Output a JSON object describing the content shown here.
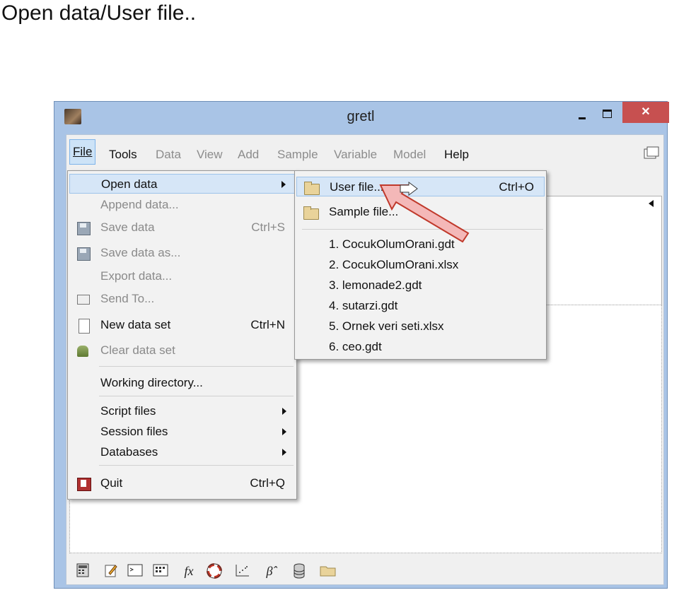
{
  "slide": {
    "title": "Open data/User file.."
  },
  "window": {
    "title": "gretl",
    "close_glyph": "✕",
    "menubar": [
      {
        "label": "File",
        "state": "active"
      },
      {
        "label": "Tools",
        "state": "enabled"
      },
      {
        "label": "Data",
        "state": "disabled"
      },
      {
        "label": "View",
        "state": "disabled"
      },
      {
        "label": "Add",
        "state": "disabled"
      },
      {
        "label": "Sample",
        "state": "disabled"
      },
      {
        "label": "Variable",
        "state": "disabled"
      },
      {
        "label": "Model",
        "state": "disabled"
      },
      {
        "label": "Help",
        "state": "enabled"
      }
    ]
  },
  "file_menu": {
    "items": [
      {
        "label": "Open data",
        "shortcut": "",
        "submenu": true,
        "highlighted": true,
        "disabled": false,
        "icon": ""
      },
      {
        "label": "Append data...",
        "shortcut": "",
        "disabled": true,
        "icon": ""
      },
      {
        "label": "Save data",
        "shortcut": "Ctrl+S",
        "disabled": true,
        "icon": "save-icon"
      },
      {
        "label": "Save data as...",
        "shortcut": "",
        "disabled": true,
        "icon": "save-as-icon"
      },
      {
        "label": "Export data...",
        "shortcut": "",
        "disabled": true,
        "icon": ""
      },
      {
        "label": "Send To...",
        "shortcut": "",
        "disabled": true,
        "icon": "send-icon"
      },
      {
        "label": "New data set",
        "shortcut": "Ctrl+N",
        "disabled": false,
        "icon": "new-document-icon"
      },
      {
        "label": "Clear data set",
        "shortcut": "",
        "disabled": true,
        "icon": "clear-icon"
      },
      {
        "label": "Working directory...",
        "shortcut": "",
        "disabled": false,
        "icon": ""
      },
      {
        "label": "Script files",
        "submenu": true,
        "disabled": false
      },
      {
        "label": "Session files",
        "submenu": true,
        "disabled": false
      },
      {
        "label": "Databases",
        "submenu": true,
        "disabled": false
      },
      {
        "label": "Quit",
        "shortcut": "Ctrl+Q",
        "disabled": false,
        "icon": "quit-icon"
      }
    ]
  },
  "open_submenu": {
    "items": [
      {
        "label": "User file...",
        "shortcut": "Ctrl+O",
        "highlighted": true,
        "icon": "folder-icon"
      },
      {
        "label": "Sample file...",
        "shortcut": "",
        "icon": "folder-icon"
      }
    ],
    "recent": [
      "1. CocukOlumOrani.gdt",
      "2. CocukOlumOrani.xlsx",
      "3. lemonade2.gdt",
      "4. sutarzi.gdt",
      "5. Ornek veri seti.xlsx",
      "6. ceo.gdt"
    ]
  },
  "toolbar": {
    "icons": [
      "calculator-icon",
      "edit-icon",
      "terminal-icon",
      "matrix-icon",
      "fx-icon",
      "lifebuoy-icon",
      "scatter-plot-icon",
      "beta-hat-icon",
      "database-icon",
      "folder-icon"
    ],
    "fx_label": "fx",
    "beta_label": "β̂"
  }
}
